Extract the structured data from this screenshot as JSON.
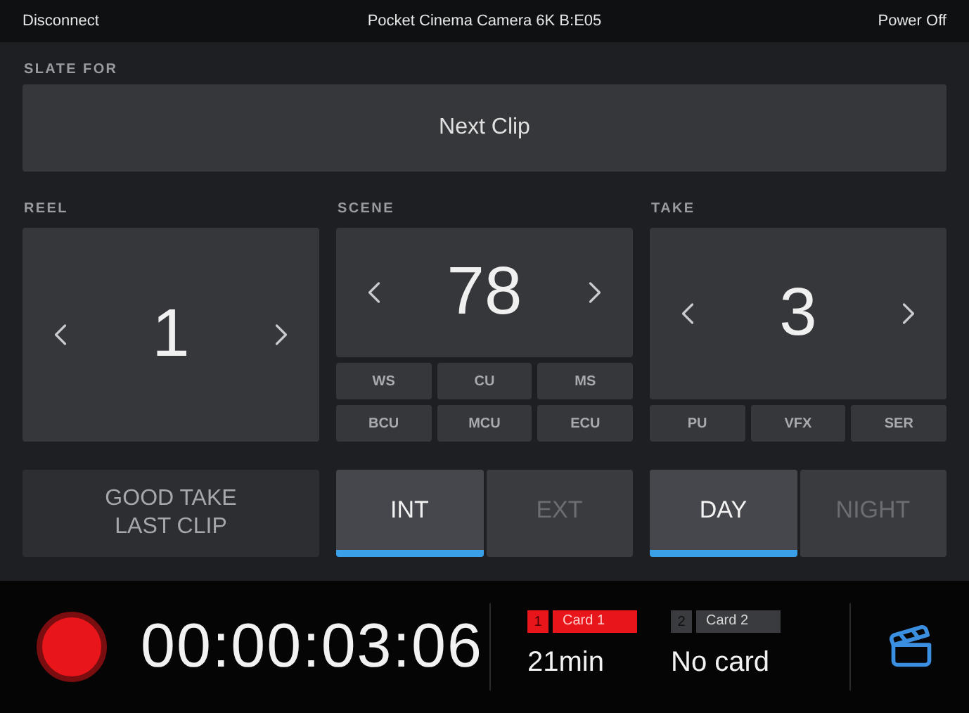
{
  "top_bar": {
    "left": "Disconnect",
    "title": "Pocket Cinema Camera 6K B:E05",
    "right": "Power Off"
  },
  "slate": {
    "label": "SLATE FOR",
    "value": "Next Clip"
  },
  "counters": [
    {
      "label": "REEL",
      "value": "1"
    },
    {
      "label": "SCENE",
      "value": "78",
      "tags": [
        "WS",
        "CU",
        "MS",
        "BCU",
        "MCU",
        "ECU"
      ]
    },
    {
      "label": "TAKE",
      "value": "3",
      "tags": [
        "PU",
        "VFX",
        "SER"
      ]
    }
  ],
  "good_take": {
    "label": "GOOD TAKE LAST CLIP"
  },
  "toggles": [
    [
      {
        "label": "INT",
        "selected": true
      },
      {
        "label": "EXT",
        "selected": false
      }
    ],
    [
      {
        "label": "DAY",
        "selected": true
      },
      {
        "label": "NIGHT",
        "selected": false
      }
    ]
  ],
  "timecode": "00:00:03:06",
  "cards": [
    {
      "number": "1",
      "name": "Card 1",
      "value": "21min",
      "active": true
    },
    {
      "number": "2",
      "name": "Card 2",
      "value": "No card",
      "active": false
    }
  ]
}
